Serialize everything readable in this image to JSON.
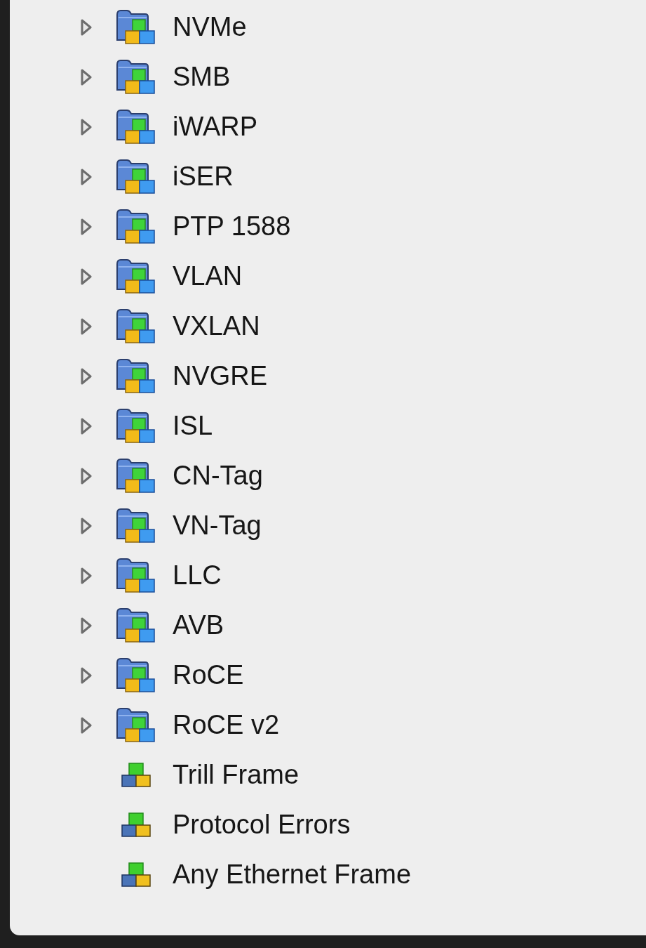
{
  "tree": {
    "items": [
      {
        "kind": "group",
        "label": "NVMe",
        "expanded": false
      },
      {
        "kind": "group",
        "label": "SMB",
        "expanded": false
      },
      {
        "kind": "group",
        "label": "iWARP",
        "expanded": false
      },
      {
        "kind": "group",
        "label": "iSER",
        "expanded": false
      },
      {
        "kind": "group",
        "label": "PTP 1588",
        "expanded": false
      },
      {
        "kind": "group",
        "label": "VLAN",
        "expanded": false
      },
      {
        "kind": "group",
        "label": "VXLAN",
        "expanded": false
      },
      {
        "kind": "group",
        "label": "NVGRE",
        "expanded": false
      },
      {
        "kind": "group",
        "label": "ISL",
        "expanded": false
      },
      {
        "kind": "group",
        "label": "CN-Tag",
        "expanded": false
      },
      {
        "kind": "group",
        "label": "VN-Tag",
        "expanded": false
      },
      {
        "kind": "group",
        "label": "LLC",
        "expanded": false
      },
      {
        "kind": "group",
        "label": "AVB",
        "expanded": false
      },
      {
        "kind": "group",
        "label": "RoCE",
        "expanded": false
      },
      {
        "kind": "group",
        "label": "RoCE v2",
        "expanded": false
      },
      {
        "kind": "item",
        "label": "Trill Frame"
      },
      {
        "kind": "item",
        "label": "Protocol Errors"
      },
      {
        "kind": "item",
        "label": "Any Ethernet Frame"
      }
    ]
  }
}
